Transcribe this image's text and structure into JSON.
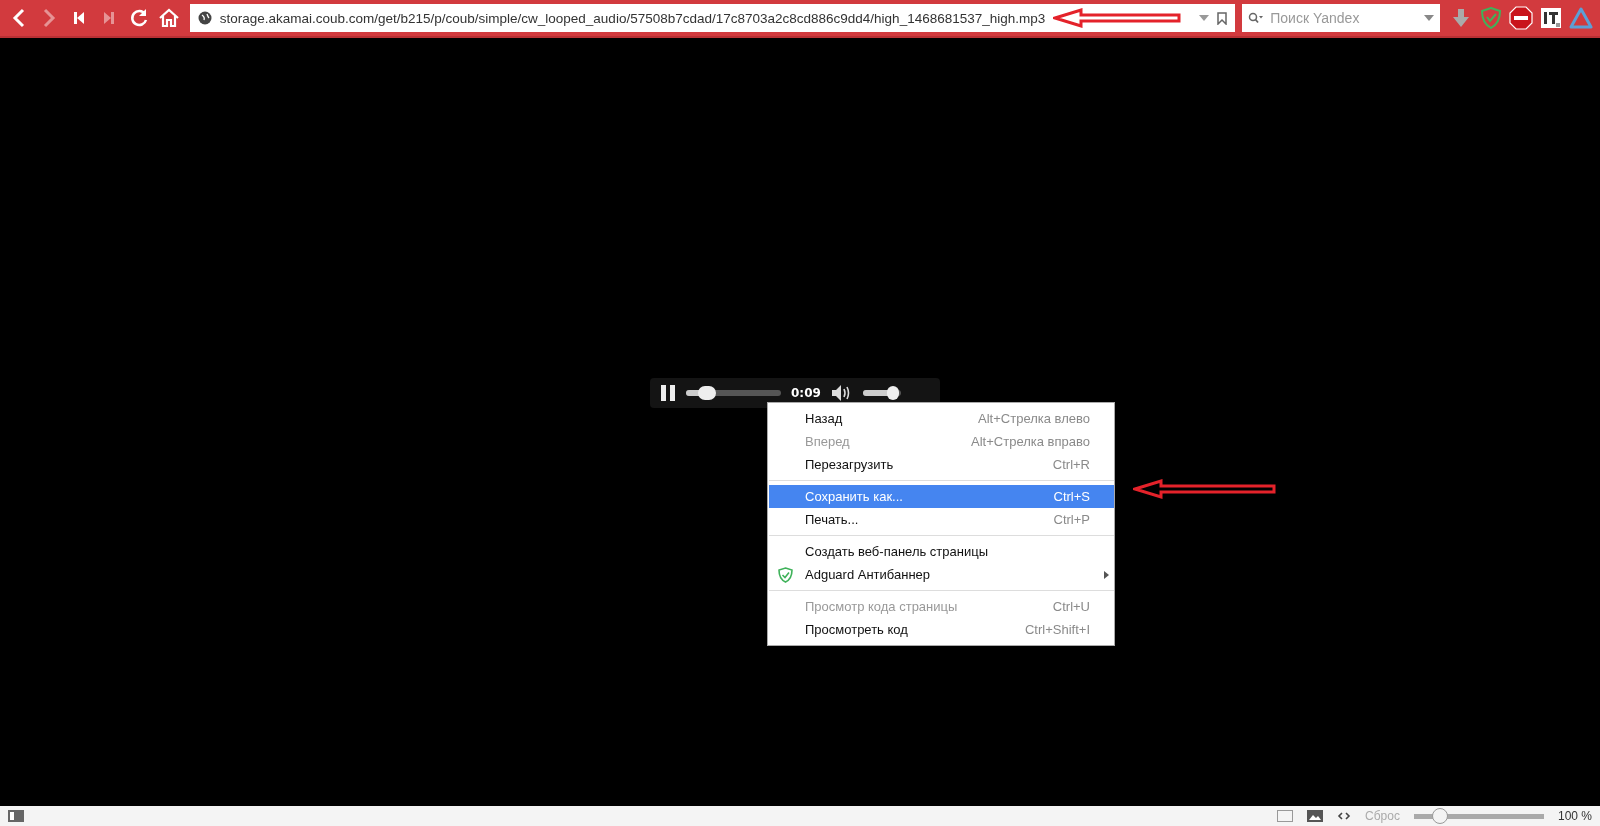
{
  "toolbar": {
    "address": "storage.akamai.coub.com/get/b215/p/coub/simple/cw_looped_audio/57508b7cdad/17c8703a2c8cd886c9dd4/high_1468681537_high.mp3",
    "search_placeholder": "Поиск Yandex"
  },
  "player": {
    "time": "0:09",
    "progress": {
      "level": 0.22
    },
    "volume": {
      "level": 0.8
    }
  },
  "context_menu": [
    {
      "kind": "item",
      "label": "Назад",
      "shortcut": "Alt+Стрелка влево",
      "disabled": false,
      "selected": false
    },
    {
      "kind": "item",
      "label": "Вперед",
      "shortcut": "Alt+Стрелка вправо",
      "disabled": true,
      "selected": false
    },
    {
      "kind": "item",
      "label": "Перезагрузить",
      "shortcut": "Ctrl+R",
      "disabled": false,
      "selected": false
    },
    {
      "kind": "separator"
    },
    {
      "kind": "item",
      "label": "Сохранить как...",
      "shortcut": "Ctrl+S",
      "disabled": false,
      "selected": true
    },
    {
      "kind": "item",
      "label": "Печать...",
      "shortcut": "Ctrl+P",
      "disabled": false,
      "selected": false
    },
    {
      "kind": "separator"
    },
    {
      "kind": "item",
      "label": "Создать веб-панель страницы",
      "disabled": false,
      "selected": false
    },
    {
      "kind": "submenu",
      "label": "Adguard Антибаннер",
      "disabled": false,
      "selected": false
    },
    {
      "kind": "separator"
    },
    {
      "kind": "item",
      "label": "Просмотр кода страницы",
      "shortcut": "Ctrl+U",
      "disabled": true,
      "selected": false
    },
    {
      "kind": "item",
      "label": "Просмотреть код",
      "shortcut": "Ctrl+Shift+I",
      "disabled": false,
      "selected": false
    }
  ],
  "status_bar": {
    "reset": "Сброс",
    "zoom": {
      "level": 0.2
    },
    "zoom_text": "100 %"
  }
}
